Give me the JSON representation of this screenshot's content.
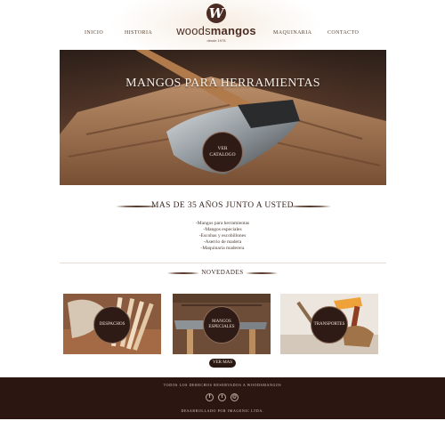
{
  "nav": {
    "inicio": "INICIO",
    "historia": "HISTORIA",
    "maquinaria": "MAQUINARIA",
    "contacto": "CONTACTO"
  },
  "logo": {
    "mark": "W",
    "name_light": "woods",
    "name_bold": "mangos",
    "since": "desde 1978"
  },
  "hero": {
    "title": "MANGOS PARA HERRAMIENTAS",
    "button": "VER CATALOGO"
  },
  "about": {
    "title": "MAS DE 35 AÑOS JUNTO A USTED",
    "features": [
      "-Mangos para herramientas",
      "-Mangos especiales",
      "-Escobas y escobillones",
      "-Aserrio de madera",
      "-Maquinaria maderera"
    ]
  },
  "news": {
    "title": "NOVEDADES",
    "cards": [
      {
        "label": "DESPACHOS"
      },
      {
        "label": "MANGOS ESPECIALES"
      },
      {
        "label": "TRANSPORTES"
      }
    ],
    "more_button": "VER MAS"
  },
  "footer": {
    "rights": "TODOS LOS DERECHOS RESERVADOS A WOODSMANGOS",
    "social": [
      {
        "icon": "facebook-icon",
        "glyph": "f"
      },
      {
        "icon": "twitter-icon",
        "glyph": "t"
      },
      {
        "icon": "email-icon",
        "glyph": "@"
      }
    ],
    "credit": "DESARROLLADO POR IMAGENIC LTDA."
  },
  "colors": {
    "brand_dark": "#2b1612",
    "brand_brown": "#4a2c22",
    "background": "#ffffff"
  }
}
